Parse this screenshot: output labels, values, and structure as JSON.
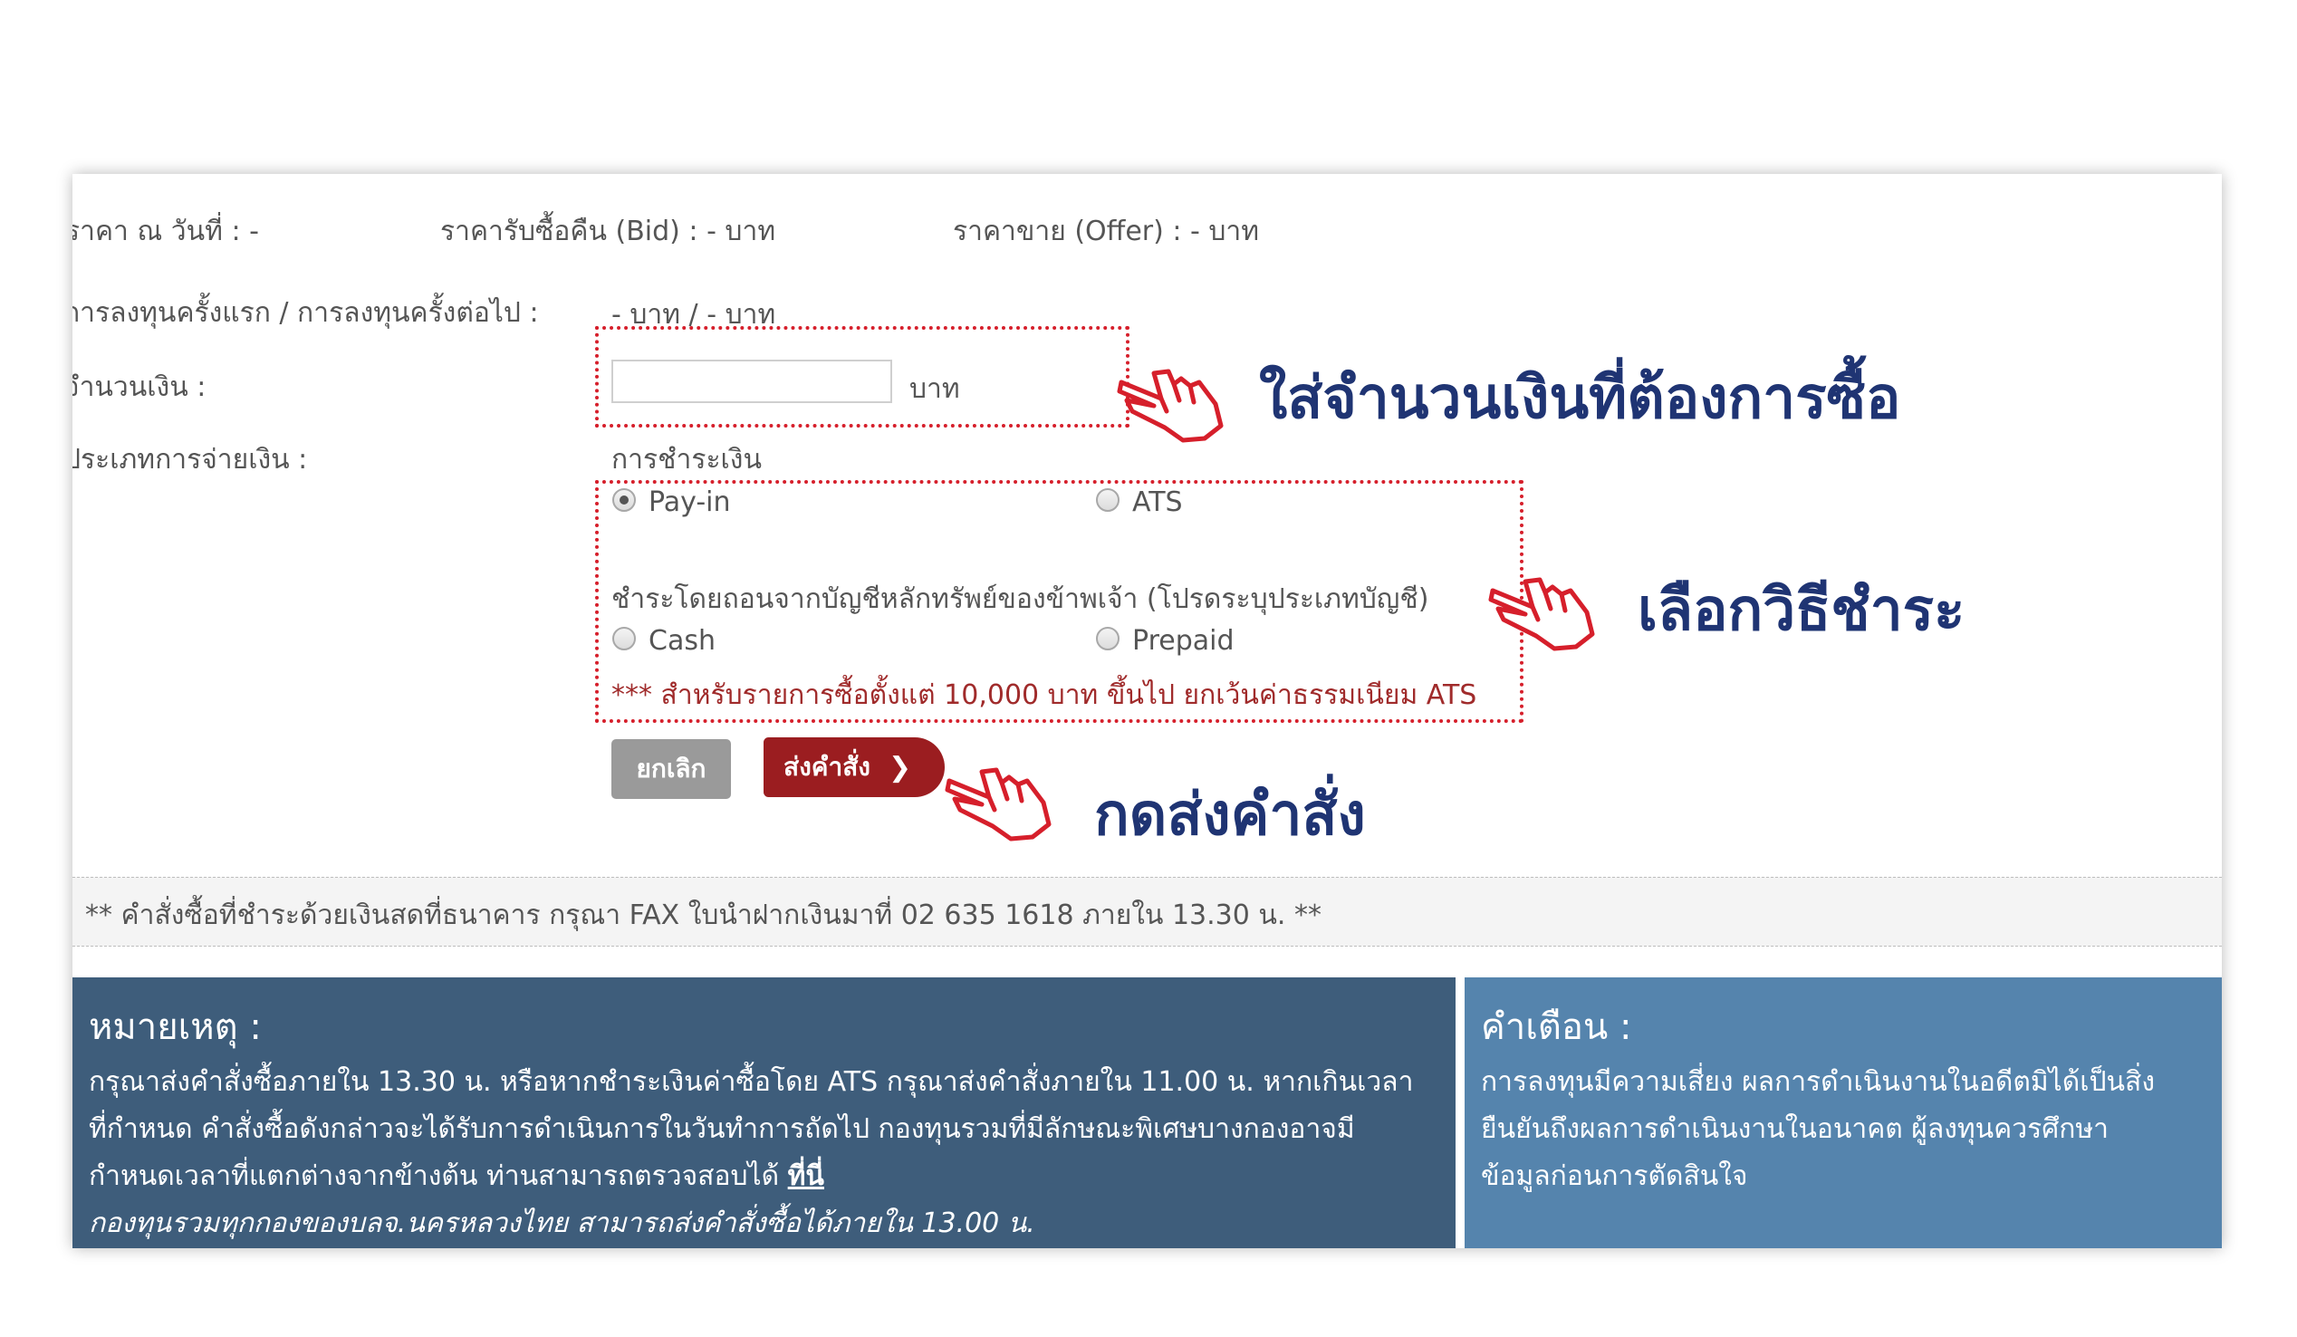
{
  "order_form": {
    "price_date": "ราคา ณ วันที่ : -",
    "bid_price": "ราคารับซื้อคืน (Bid) : - บาท",
    "offer_price": "ราคาขาย (Offer) : - บาท",
    "investment_label": "การลงทุนครั้งแรก / การลงทุนครั้งต่อไป :",
    "investment_value": "- บาท / - บาท",
    "amount_label": "จำนวนเงิน :",
    "amount_value": "",
    "amount_unit": "บาท",
    "payment_type_label": "ประเภทการจ่ายเงิน :",
    "payment_heading": "การชำระเงิน",
    "option_payin": "Pay-in",
    "option_ats": "ATS",
    "withdraw_heading": "ชำระโดยถอนจากบัญชีหลักทรัพย์ของข้าพเจ้า (โปรดระบุประเภทบัญชี)",
    "option_cash": "Cash",
    "option_prepaid": "Prepaid",
    "ats_note": "*** สำหรับรายการซื้อตั้งแต่ 10,000 บาท ขึ้นไป ยกเว้นค่าธรรมเนียม ATS",
    "selected_payment": "Pay-in"
  },
  "buttons": {
    "cancel": "ยกเลิก",
    "submit": "ส่งคำสั่ง"
  },
  "annotations": {
    "enter_amount": "ใส่จำนวนเงินที่ต้องการซื้อ",
    "choose_method": "เลือกวิธีชำระ",
    "press_submit": "กดส่งคำสั่ง"
  },
  "fax_notice": "** คำสั่งซื้อที่ชำระด้วยเงินสดที่ธนาคาร กรุณา FAX ใบนำฝากเงินมาที่ 02 635 1618 ภายใน 13.30 น. **",
  "remarks": {
    "title": "หมายเหตุ :",
    "line1": "กรุณาส่งคำสั่งซื้อภายใน 13.30 น. หรือหากชำระเงินค่าซื้อโดย ATS กรุณาส่งคำสั่งภายใน 11.00 น. หากเกินเวลา",
    "line2": "ที่กำหนด คำสั่งซื้อดังกล่าวจะได้รับการดำเนินการในวันทำการถัดไป กองทุนรวมที่มีลักษณะพิเศษบางกองอาจมี",
    "line3": "กำหนดเวลาที่แตกต่างจากข้างต้น ท่านสามารถตรวจสอบได้",
    "link": "ที่นี่",
    "line4": "กองทุนรวมทุกกองของบลจ.นครหลวงไทย สามารถส่งคำสั่งซื้อได้ภายใน 13.00 น."
  },
  "warning": {
    "title": "คำเตือน :",
    "line1": "การลงทุนมีความเสี่ยง ผลการดำเนินงานในอดีตมิได้เป็นสิ่ง",
    "line2": "ยืนยันถึงผลการดำเนินงานในอนาคต ผู้ลงทุนควรศึกษา",
    "line3": "ข้อมูลก่อนการตัดสินใจ"
  },
  "colors": {
    "annotation_text": "#1f3473",
    "dotted_box": "#d61f2b",
    "submit_button": "#9b1d20",
    "cancel_button": "#9a9a9a",
    "remarks_bg": "#3e5d7b",
    "warning_bg": "#5584ad",
    "note_red": "#a02b2b"
  },
  "icons": [
    "pointing-hand-icon",
    "chevron-right-icon"
  ]
}
